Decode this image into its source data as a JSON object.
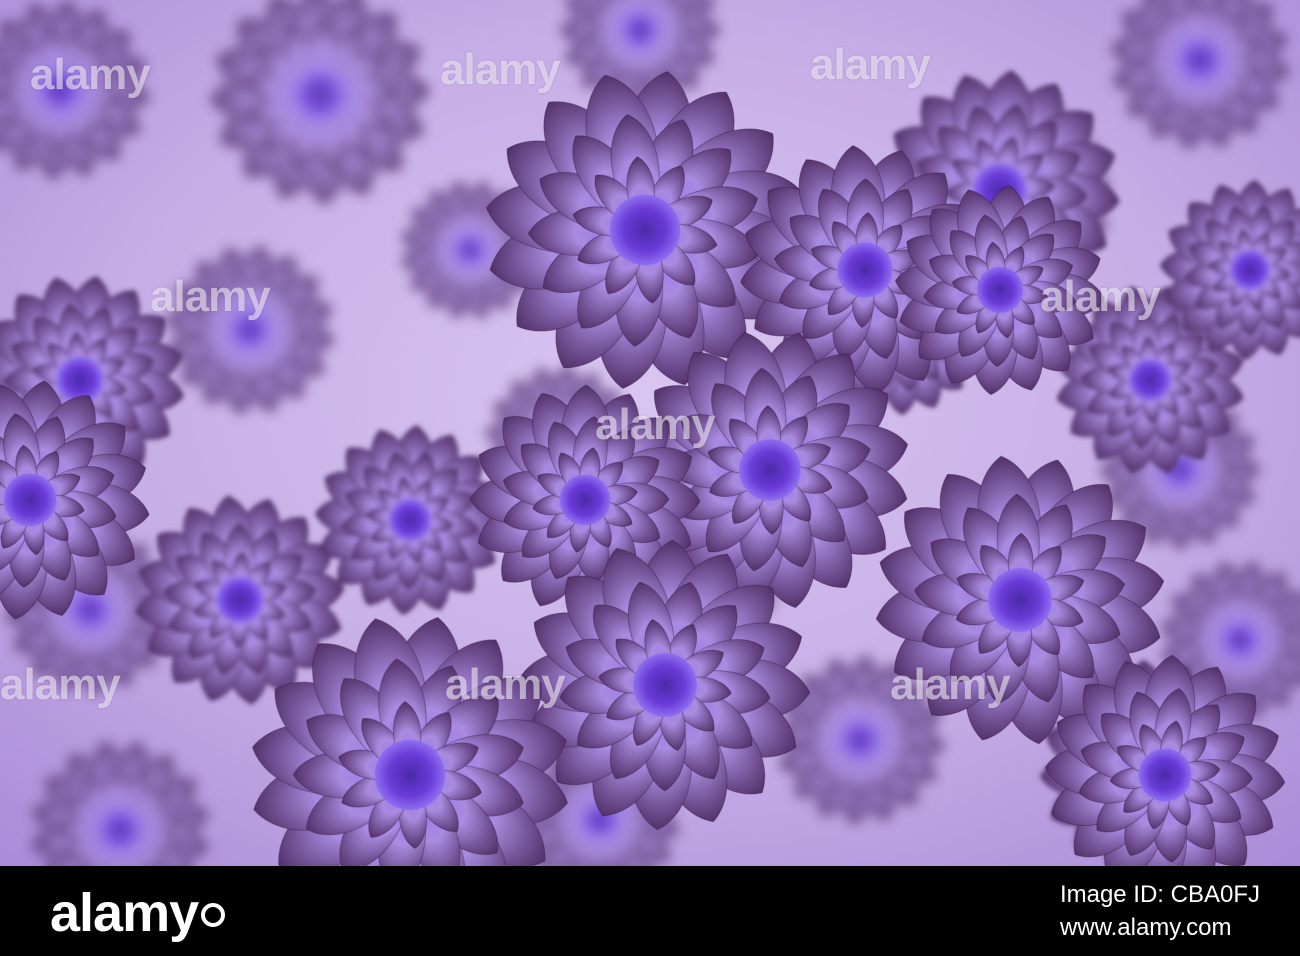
{
  "image": {
    "palette": {
      "background": "#d9c4ec",
      "mid": "#a98be0",
      "dark": "#3c1a4a",
      "center": "#6a3ad8",
      "footer": "#000000"
    }
  },
  "watermark": {
    "text": "alamy"
  },
  "footer": {
    "logo_text": "alamy",
    "image_id_label": "Image ID: CBA0FJ",
    "url": "www.alamy.com"
  }
}
